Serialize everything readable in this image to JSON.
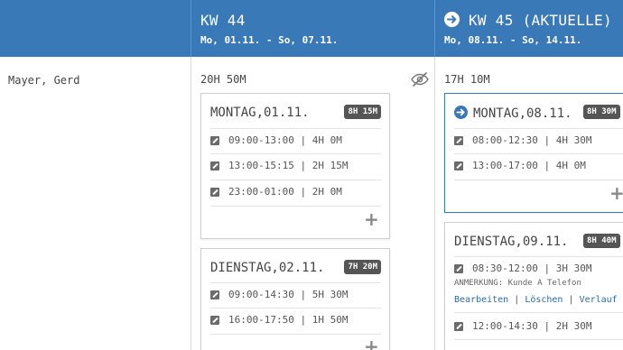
{
  "person": {
    "name": "Mayer, Gerd"
  },
  "weeks": [
    {
      "title": "KW 44",
      "dates": "Mo, 01.11. - So, 07.11.",
      "total": "20H 50M",
      "days": [
        {
          "title": "MONTAG,01.11.",
          "hours": "8H 15M",
          "entries": [
            {
              "text": "09:00-13:00 | 4H 0M"
            },
            {
              "text": "13:00-15:15 | 2H 15M"
            },
            {
              "text": "23:00-01:00 | 2H 0M"
            }
          ]
        },
        {
          "title": "DIENSTAG,02.11.",
          "hours": "7H 20M",
          "entries": [
            {
              "text": "09:00-14:30 | 5H 30M"
            },
            {
              "text": "16:00-17:50 | 1H 50M"
            }
          ]
        }
      ]
    },
    {
      "title": "KW 45 (AKTUELLE)",
      "dates": "Mo, 08.11. - So, 14.11.",
      "total": "17H 10M",
      "days": [
        {
          "title": "MONTAG,08.11.",
          "hours": "8H 30M",
          "entries": [
            {
              "text": "08:00-12:30 | 4H 30M"
            },
            {
              "text": "13:00-17:00 | 4H 0M"
            }
          ]
        },
        {
          "title": "DIENSTAG,09.11.",
          "hours": "8H 40M",
          "entries": [
            {
              "text": "08:30-12:00 | 3H 30M",
              "note": "ANMERKUNG: Kunde A Telefon",
              "actions": {
                "edit": "Bearbeiten",
                "delete": "Löschen",
                "history": "Verlauf"
              }
            },
            {
              "text": "12:00-14:30 | 2H 30M"
            }
          ]
        }
      ]
    }
  ],
  "labels": {
    "add": "+",
    "separator": "|"
  },
  "colors": {
    "header": "#3a79b7",
    "badge": "#555555",
    "link": "#2d6aa8"
  },
  "icons": {
    "visibility": "eye-slash-icon",
    "current_week": "arrow-right-circle-icon",
    "edit": "edit-icon",
    "add": "plus-icon"
  }
}
